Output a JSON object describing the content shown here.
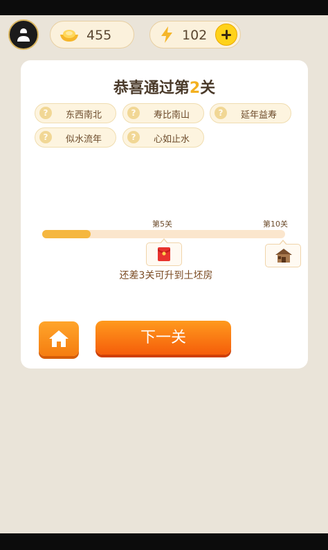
{
  "header": {
    "gold": "455",
    "energy": "102"
  },
  "result": {
    "title_prefix": "恭喜通过第",
    "level": "2",
    "title_suffix": "关"
  },
  "idioms": [
    "东西南北",
    "寿比南山",
    "延年益寿",
    "似水流年",
    "心如止水"
  ],
  "progress": {
    "fraction": 0.2,
    "stage5_label": "第5关",
    "stage10_label": "第10关",
    "remaining_text": "还差3关可升到土坯房"
  },
  "buttons": {
    "next_label": "下一关"
  },
  "colors": {
    "accent": "#f3b020",
    "button_orange": "#f57d10",
    "background": "#eae4d9"
  }
}
